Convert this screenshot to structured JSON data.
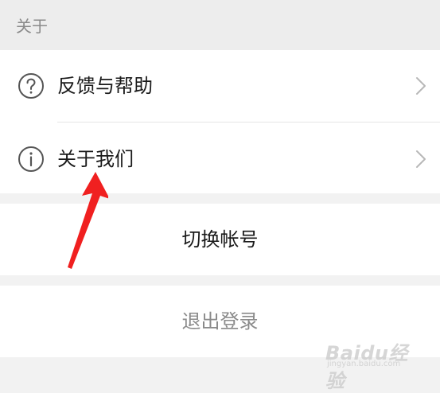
{
  "section": {
    "header": "关于"
  },
  "rows": [
    {
      "label": "反馈与帮助",
      "icon": "question-circle-icon"
    },
    {
      "label": "关于我们",
      "icon": "info-circle-icon"
    }
  ],
  "actions": {
    "switch_account": "切换帐号",
    "logout": "退出登录"
  },
  "watermark": {
    "brand": "Baidu经验",
    "domain": "jingyan.baidu.com"
  },
  "colors": {
    "background": "#f2f2f2",
    "card": "#ffffff",
    "text_primary": "#1a1a1a",
    "text_muted": "#8a8a8a",
    "annotation_arrow": "#f02020"
  }
}
